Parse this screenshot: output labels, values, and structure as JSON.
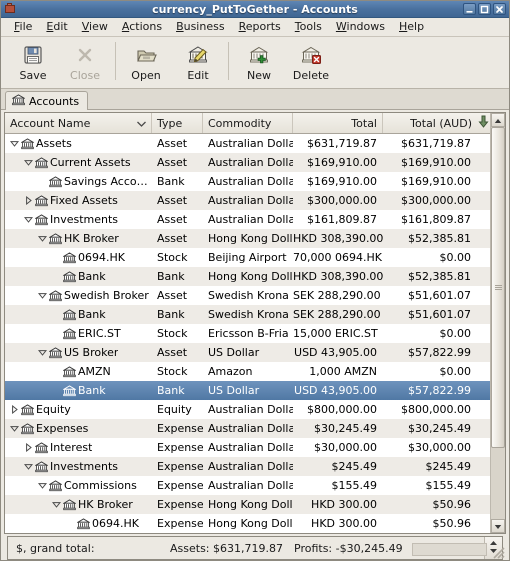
{
  "window": {
    "title": "currency_PutToGether - Accounts",
    "icon": "app-icon",
    "buttons": [
      {
        "name": "minimize-button",
        "glyph": "minimize-icon"
      },
      {
        "name": "maximize-button",
        "glyph": "maximize-icon"
      },
      {
        "name": "close-button",
        "glyph": "close-icon"
      }
    ]
  },
  "menubar": {
    "items": [
      {
        "label": "File",
        "mnemonic": "F"
      },
      {
        "label": "Edit",
        "mnemonic": "E"
      },
      {
        "label": "View",
        "mnemonic": "V"
      },
      {
        "label": "Actions",
        "mnemonic": "A"
      },
      {
        "label": "Business",
        "mnemonic": "B"
      },
      {
        "label": "Reports",
        "mnemonic": "R"
      },
      {
        "label": "Tools",
        "mnemonic": "T"
      },
      {
        "label": "Windows",
        "mnemonic": "W"
      },
      {
        "label": "Help",
        "mnemonic": "H"
      }
    ]
  },
  "toolbar": {
    "items": [
      {
        "label": "Save",
        "icon": "save-floppy-icon",
        "enabled": true
      },
      {
        "label": "Close",
        "icon": "close-x-icon",
        "enabled": false
      },
      {
        "label": "Open",
        "icon": "open-folder-icon",
        "enabled": true
      },
      {
        "label": "Edit",
        "icon": "edit-pencil-icon",
        "enabled": true
      },
      {
        "label": "New",
        "icon": "new-account-icon",
        "enabled": true
      },
      {
        "label": "Delete",
        "icon": "delete-account-icon",
        "enabled": true
      }
    ]
  },
  "tabs": [
    {
      "label": "Accounts",
      "icon": "accounts-bank-icon",
      "active": true
    }
  ],
  "tree": {
    "columns": [
      {
        "key": "name",
        "label": "Account Name",
        "align": "left",
        "sort_indicator": "chevron-down-icon"
      },
      {
        "key": "type",
        "label": "Type",
        "align": "left"
      },
      {
        "key": "commodity",
        "label": "Commodity",
        "align": "left"
      },
      {
        "key": "total",
        "label": "Total",
        "align": "right"
      },
      {
        "key": "total_aud",
        "label": "Total (AUD)",
        "align": "right"
      }
    ],
    "column_picker_icon": "column-chooser-arrow-icon",
    "rows": [
      {
        "depth": 0,
        "expander": "expanded",
        "icon": "bank-icon",
        "name": "Assets",
        "type": "Asset",
        "commodity": "Australian Dollar",
        "total": "$631,719.87",
        "total_aud": "$631,719.87",
        "selected": false
      },
      {
        "depth": 1,
        "expander": "expanded",
        "icon": "bank-icon",
        "name": "Current Assets",
        "type": "Asset",
        "commodity": "Australian Dollar",
        "total": "$169,910.00",
        "total_aud": "$169,910.00",
        "selected": false
      },
      {
        "depth": 2,
        "expander": "none",
        "icon": "bank-icon",
        "name": "Savings Account",
        "type": "Bank",
        "commodity": "Australian Dollar",
        "total": "$169,910.00",
        "total_aud": "$169,910.00",
        "selected": false
      },
      {
        "depth": 1,
        "expander": "collapsed",
        "icon": "bank-icon",
        "name": "Fixed Assets",
        "type": "Asset",
        "commodity": "Australian Dollar",
        "total": "$300,000.00",
        "total_aud": "$300,000.00",
        "selected": false
      },
      {
        "depth": 1,
        "expander": "expanded",
        "icon": "bank-icon",
        "name": "Investments",
        "type": "Asset",
        "commodity": "Australian Dollar",
        "total": "$161,809.87",
        "total_aud": "$161,809.87",
        "selected": false
      },
      {
        "depth": 2,
        "expander": "expanded",
        "icon": "bank-icon",
        "name": "HK Broker",
        "type": "Asset",
        "commodity": "Hong Kong Dollar",
        "total": "HKD 308,390.00",
        "total_aud": "$52,385.81",
        "selected": false
      },
      {
        "depth": 3,
        "expander": "none",
        "icon": "bank-icon",
        "name": "0694.HK",
        "type": "Stock",
        "commodity": "Beijing Airport",
        "total": "70,000 0694.HK",
        "total_aud": "$0.00",
        "selected": false
      },
      {
        "depth": 3,
        "expander": "none",
        "icon": "bank-icon",
        "name": "Bank",
        "type": "Bank",
        "commodity": "Hong Kong Dollar",
        "total": "HKD 308,390.00",
        "total_aud": "$52,385.81",
        "selected": false
      },
      {
        "depth": 2,
        "expander": "expanded",
        "icon": "bank-icon",
        "name": "Swedish Broker",
        "type": "Asset",
        "commodity": "Swedish Krona",
        "total": "SEK 288,290.00",
        "total_aud": "$51,601.07",
        "selected": false
      },
      {
        "depth": 3,
        "expander": "none",
        "icon": "bank-icon",
        "name": "Bank",
        "type": "Bank",
        "commodity": "Swedish Krona",
        "total": "SEK 288,290.00",
        "total_aud": "$51,601.07",
        "selected": false
      },
      {
        "depth": 3,
        "expander": "none",
        "icon": "bank-icon",
        "name": "ERIC.ST",
        "type": "Stock",
        "commodity": "Ericsson B-Fria",
        "total": "15,000 ERIC.ST",
        "total_aud": "$0.00",
        "selected": false
      },
      {
        "depth": 2,
        "expander": "expanded",
        "icon": "bank-icon",
        "name": "US Broker",
        "type": "Asset",
        "commodity": "US Dollar",
        "total": "USD 43,905.00",
        "total_aud": "$57,822.99",
        "selected": false
      },
      {
        "depth": 3,
        "expander": "none",
        "icon": "bank-icon",
        "name": "AMZN",
        "type": "Stock",
        "commodity": "Amazon",
        "total": "1,000 AMZN",
        "total_aud": "$0.00",
        "selected": false
      },
      {
        "depth": 3,
        "expander": "none",
        "icon": "bank-icon",
        "name": "Bank",
        "type": "Bank",
        "commodity": "US Dollar",
        "total": "USD 43,905.00",
        "total_aud": "$57,822.99",
        "selected": true
      },
      {
        "depth": 0,
        "expander": "collapsed",
        "icon": "bank-icon",
        "name": "Equity",
        "type": "Equity",
        "commodity": "Australian Dollar",
        "total": "$800,000.00",
        "total_aud": "$800,000.00",
        "selected": false
      },
      {
        "depth": 0,
        "expander": "expanded",
        "icon": "bank-icon",
        "name": "Expenses",
        "type": "Expense",
        "commodity": "Australian Dollar",
        "total": "$30,245.49",
        "total_aud": "$30,245.49",
        "selected": false
      },
      {
        "depth": 1,
        "expander": "collapsed",
        "icon": "bank-icon",
        "name": "Interest",
        "type": "Expense",
        "commodity": "Australian Dollar",
        "total": "$30,000.00",
        "total_aud": "$30,000.00",
        "selected": false
      },
      {
        "depth": 1,
        "expander": "expanded",
        "icon": "bank-icon",
        "name": "Investments",
        "type": "Expense",
        "commodity": "Australian Dollar",
        "total": "$245.49",
        "total_aud": "$245.49",
        "selected": false
      },
      {
        "depth": 2,
        "expander": "expanded",
        "icon": "bank-icon",
        "name": "Commissions",
        "type": "Expense",
        "commodity": "Australian Dollar",
        "total": "$155.49",
        "total_aud": "$155.49",
        "selected": false
      },
      {
        "depth": 3,
        "expander": "expanded",
        "icon": "bank-icon",
        "name": "HK Broker",
        "type": "Expense",
        "commodity": "Hong Kong Dollar",
        "total": "HKD 300.00",
        "total_aud": "$50.96",
        "selected": false
      },
      {
        "depth": 4,
        "expander": "none",
        "icon": "bank-icon",
        "name": "0694.HK",
        "type": "Expense",
        "commodity": "Hong Kong Dollar",
        "total": "HKD 300.00",
        "total_aud": "$50.96",
        "selected": false
      }
    ]
  },
  "scrollbar": {
    "up_icon": "scroll-up-arrow-icon",
    "down_icon": "scroll-down-arrow-icon",
    "thumb_top_percent": 0,
    "thumb_height_percent": 82
  },
  "statusbar": {
    "label": "$, grand total:",
    "assets": "Assets: $631,719.87",
    "profits": "Profits: -$30,245.49",
    "spinner_icon": "spin-updown-icon"
  },
  "colors": {
    "titlebar_from": "#5f86b4",
    "titlebar_to": "#3f6693",
    "selection": "#5a7fa8",
    "chrome": "#ece9e2",
    "row_alt": "#eeebe6"
  }
}
